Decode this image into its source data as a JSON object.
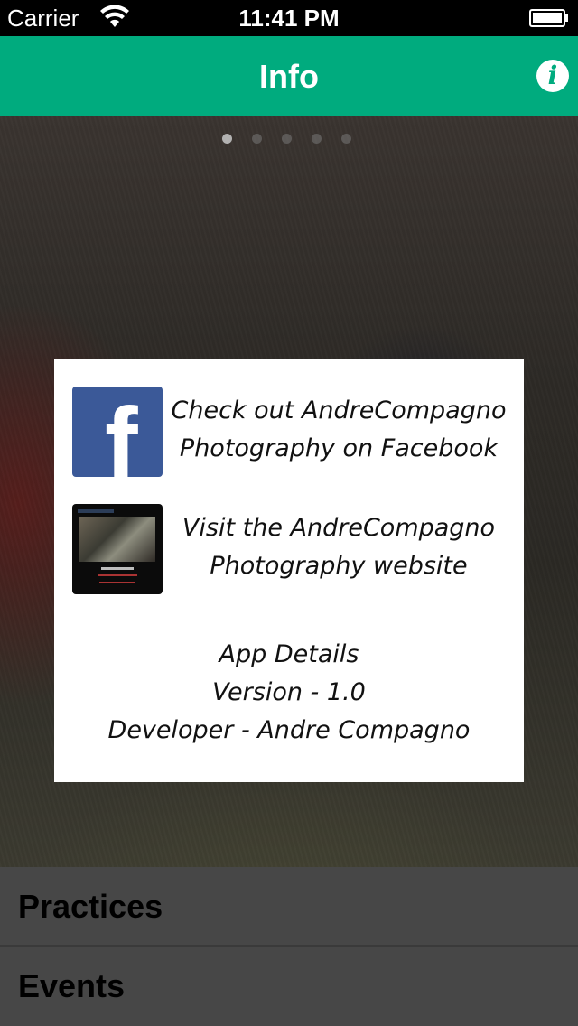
{
  "status_bar": {
    "carrier": "Carrier",
    "time": "11:41 PM",
    "wifi_icon": "wifi-icon",
    "battery_icon": "battery-icon"
  },
  "nav": {
    "title": "Info",
    "info_button_glyph": "i",
    "accent_color": "#00ab7e"
  },
  "pager": {
    "page_count": 5,
    "current_page": 1
  },
  "card": {
    "facebook": {
      "icon": "facebook-icon",
      "line1": "Check out AndreCompagno",
      "line2": "Photography on Facebook"
    },
    "website": {
      "icon": "website-thumbnail",
      "line1": "Visit the AndreCompagno",
      "line2": "Photography website"
    },
    "details": {
      "heading": "App Details",
      "version": "Version - 1.0",
      "developer": "Developer - Andre Compagno"
    }
  },
  "bottom_list": {
    "items": [
      {
        "label": "Practices"
      },
      {
        "label": "Events"
      }
    ]
  }
}
